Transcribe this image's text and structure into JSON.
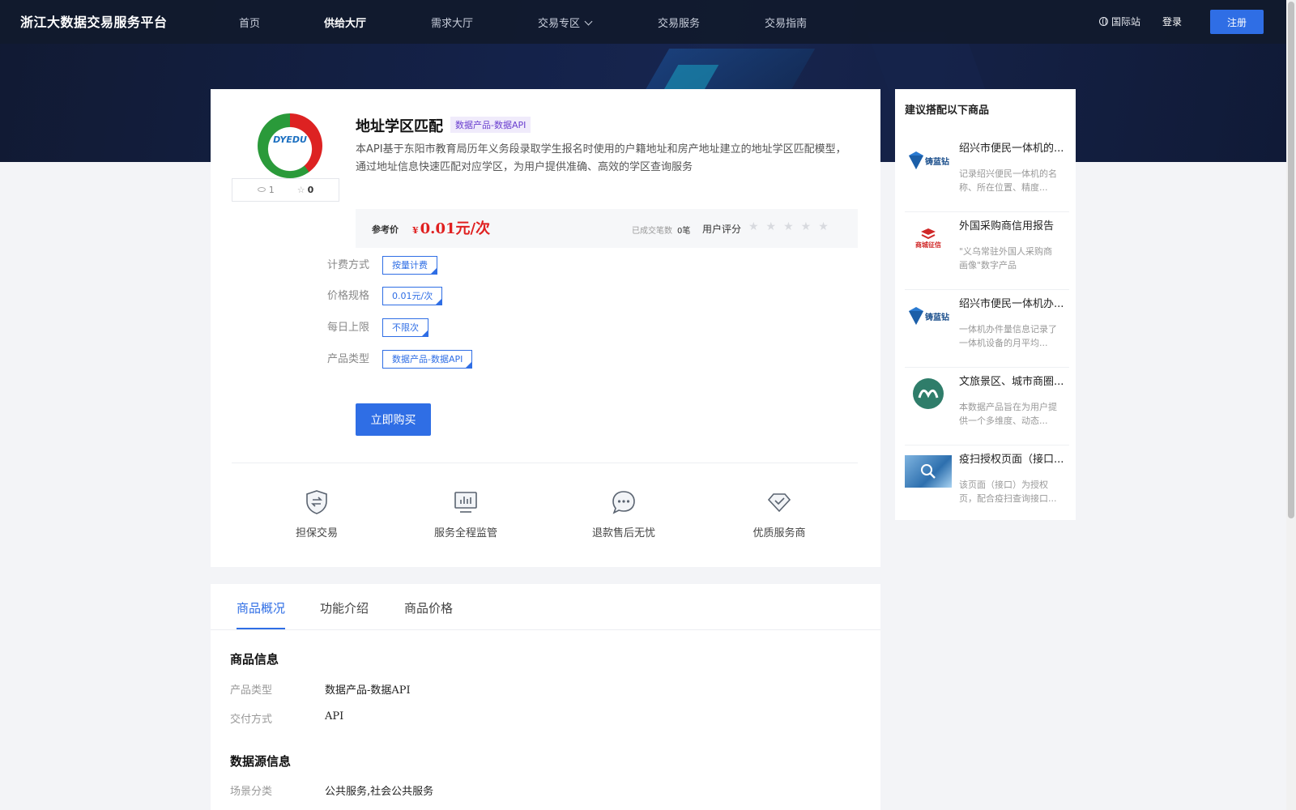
{
  "header": {
    "brand": "浙江大数据交易服务平台",
    "nav": [
      "首页",
      "供给大厅",
      "需求大厅",
      "交易专区",
      "交易服务",
      "交易指南"
    ],
    "intl": "国际站",
    "login": "登录",
    "register": "注册"
  },
  "product": {
    "logo_text": "DYEDU",
    "views": "1",
    "favorites": "0",
    "title": "地址学区匹配",
    "tag": "数据产品-数据API",
    "description": "本API基于东阳市教育局历年义务段录取学生报名时使用的户籍地址和房产地址建立的地址学区匹配模型，通过地址信息快速匹配对应学区，为用户提供准确、高效的学区查询服务",
    "price_label": "参考价",
    "currency": "¥",
    "price": "0.01元/次",
    "deal_label": "已成交笔数",
    "deal_count": "0笔",
    "rating_label": "用户评分",
    "rating_stars": "★★★★★",
    "specs": [
      {
        "label": "计费方式",
        "value": "按量计费"
      },
      {
        "label": "价格规格",
        "value": "0.01元/次"
      },
      {
        "label": "每日上限",
        "value": "不限次"
      },
      {
        "label": "产品类型",
        "value": "数据产品-数据API"
      }
    ],
    "buy_label": "立即购买",
    "features": [
      "担保交易",
      "服务全程监管",
      "退款售后无忧",
      "优质服务商"
    ]
  },
  "recommend": {
    "title": "建议搭配以下商品",
    "items": [
      {
        "logo": "铸蓝钻",
        "name": "绍兴市便民一体机的...",
        "desc": "记录绍兴便民一体机的名称、所在位置、精度..."
      },
      {
        "logo": "商城征信",
        "name": "外国采购商信用报告",
        "desc": "\"义乌常驻外国人采购商画像\"数字产品"
      },
      {
        "logo": "铸蓝钻",
        "name": "绍兴市便民一体机办...",
        "desc": "一体机办件量信息记录了一体机设备的月平均..."
      },
      {
        "logo": "",
        "name": "文旅景区、城市商圈...",
        "desc": "本数据产品旨在为用户提供一个多维度、动态..."
      },
      {
        "logo": "",
        "name": "疫扫授权页面（接口...",
        "desc": "该页面（接口）为授权页，配合疫扫查询接口..."
      }
    ]
  },
  "tabs": {
    "items": [
      "商品概况",
      "功能介绍",
      "商品价格"
    ],
    "section1_title": "商品信息",
    "info": [
      {
        "key": "产品类型",
        "value": "数据产品-数据API"
      },
      {
        "key": "交付方式",
        "value": "API"
      }
    ],
    "section2_title": "数据源信息",
    "source": [
      {
        "key": "场景分类",
        "value": "公共服务,社会公共服务"
      }
    ]
  },
  "colors": {
    "accent": "#2f6ee5",
    "price": "#e02020",
    "header_bg": "#111a2d"
  }
}
